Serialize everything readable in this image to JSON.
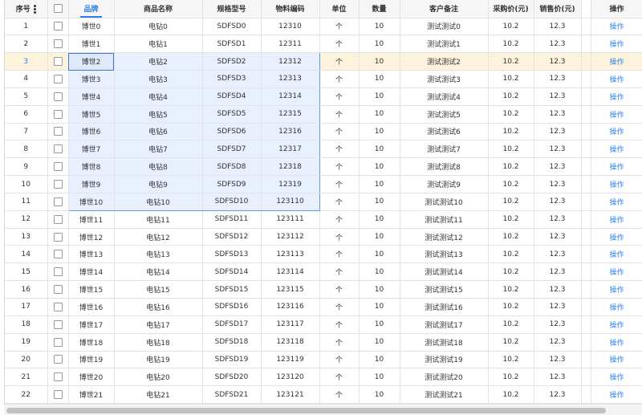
{
  "columns": {
    "idx": "序号",
    "brand": "品牌",
    "name": "商品名称",
    "spec": "规格型号",
    "code": "物料编码",
    "unit": "单位",
    "qty": "数量",
    "note": "客户备注",
    "buy": "采购价(元)",
    "sell": "销售价(元)",
    "action": "操作"
  },
  "icons": {
    "column_menu": "kebab-menu-icon",
    "row_select": "checkbox-icon"
  },
  "colors": {
    "accent": "#2f80ed",
    "highlight_row": "#fdf2dc",
    "selection": "#e8f0fd"
  },
  "highlighted_row": 3,
  "selected_range": {
    "from_row": 3,
    "to_row": 11,
    "from_col": "brand",
    "to_col": "code"
  },
  "rows": [
    {
      "idx": "1",
      "brand": "博世0",
      "name": "电钻0",
      "spec": "SDFSD0",
      "code": "12310",
      "unit": "个",
      "qty": "10",
      "note": "测试测试0",
      "buy": "10.2",
      "sell": "12.3",
      "action": "操作"
    },
    {
      "idx": "2",
      "brand": "博世1",
      "name": "电钻1",
      "spec": "SDFSD1",
      "code": "12311",
      "unit": "个",
      "qty": "10",
      "note": "测试测试1",
      "buy": "10.2",
      "sell": "12.3",
      "action": "操作"
    },
    {
      "idx": "3",
      "brand": "博世2",
      "name": "电钻2",
      "spec": "SDFSD2",
      "code": "12312",
      "unit": "个",
      "qty": "10",
      "note": "测试测试2",
      "buy": "10.2",
      "sell": "12.3",
      "action": "操作"
    },
    {
      "idx": "4",
      "brand": "博世3",
      "name": "电钻3",
      "spec": "SDFSD3",
      "code": "12313",
      "unit": "个",
      "qty": "10",
      "note": "测试测试3",
      "buy": "10.2",
      "sell": "12.3",
      "action": "操作"
    },
    {
      "idx": "5",
      "brand": "博世4",
      "name": "电钻4",
      "spec": "SDFSD4",
      "code": "12314",
      "unit": "个",
      "qty": "10",
      "note": "测试测试4",
      "buy": "10.2",
      "sell": "12.3",
      "action": "操作"
    },
    {
      "idx": "6",
      "brand": "博世5",
      "name": "电钻5",
      "spec": "SDFSD5",
      "code": "12315",
      "unit": "个",
      "qty": "10",
      "note": "测试测试5",
      "buy": "10.2",
      "sell": "12.3",
      "action": "操作"
    },
    {
      "idx": "7",
      "brand": "博世6",
      "name": "电钻6",
      "spec": "SDFSD6",
      "code": "12316",
      "unit": "个",
      "qty": "10",
      "note": "测试测试6",
      "buy": "10.2",
      "sell": "12.3",
      "action": "操作"
    },
    {
      "idx": "8",
      "brand": "博世7",
      "name": "电钻7",
      "spec": "SDFSD7",
      "code": "12317",
      "unit": "个",
      "qty": "10",
      "note": "测试测试7",
      "buy": "10.2",
      "sell": "12.3",
      "action": "操作"
    },
    {
      "idx": "9",
      "brand": "博世8",
      "name": "电钻8",
      "spec": "SDFSD8",
      "code": "12318",
      "unit": "个",
      "qty": "10",
      "note": "测试测试8",
      "buy": "10.2",
      "sell": "12.3",
      "action": "操作"
    },
    {
      "idx": "10",
      "brand": "博世9",
      "name": "电钻9",
      "spec": "SDFSD9",
      "code": "12319",
      "unit": "个",
      "qty": "10",
      "note": "测试测试9",
      "buy": "10.2",
      "sell": "12.3",
      "action": "操作"
    },
    {
      "idx": "11",
      "brand": "博世10",
      "name": "电钻10",
      "spec": "SDFSD10",
      "code": "123110",
      "unit": "个",
      "qty": "10",
      "note": "测试测试10",
      "buy": "10.2",
      "sell": "12.3",
      "action": "操作"
    },
    {
      "idx": "12",
      "brand": "博世11",
      "name": "电钻11",
      "spec": "SDFSD11",
      "code": "123111",
      "unit": "个",
      "qty": "10",
      "note": "测试测试11",
      "buy": "10.2",
      "sell": "12.3",
      "action": "操作"
    },
    {
      "idx": "13",
      "brand": "博世12",
      "name": "电钻12",
      "spec": "SDFSD12",
      "code": "123112",
      "unit": "个",
      "qty": "10",
      "note": "测试测试12",
      "buy": "10.2",
      "sell": "12.3",
      "action": "操作"
    },
    {
      "idx": "14",
      "brand": "博世13",
      "name": "电钻13",
      "spec": "SDFSD13",
      "code": "123113",
      "unit": "个",
      "qty": "10",
      "note": "测试测试13",
      "buy": "10.2",
      "sell": "12.3",
      "action": "操作"
    },
    {
      "idx": "15",
      "brand": "博世14",
      "name": "电钻14",
      "spec": "SDFSD14",
      "code": "123114",
      "unit": "个",
      "qty": "10",
      "note": "测试测试14",
      "buy": "10.2",
      "sell": "12.3",
      "action": "操作"
    },
    {
      "idx": "16",
      "brand": "博世15",
      "name": "电钻15",
      "spec": "SDFSD15",
      "code": "123115",
      "unit": "个",
      "qty": "10",
      "note": "测试测试15",
      "buy": "10.2",
      "sell": "12.3",
      "action": "操作"
    },
    {
      "idx": "17",
      "brand": "博世16",
      "name": "电钻16",
      "spec": "SDFSD16",
      "code": "123116",
      "unit": "个",
      "qty": "10",
      "note": "测试测试16",
      "buy": "10.2",
      "sell": "12.3",
      "action": "操作"
    },
    {
      "idx": "18",
      "brand": "博世17",
      "name": "电钻17",
      "spec": "SDFSD17",
      "code": "123117",
      "unit": "个",
      "qty": "10",
      "note": "测试测试17",
      "buy": "10.2",
      "sell": "12.3",
      "action": "操作"
    },
    {
      "idx": "19",
      "brand": "博世18",
      "name": "电钻18",
      "spec": "SDFSD18",
      "code": "123118",
      "unit": "个",
      "qty": "10",
      "note": "测试测试18",
      "buy": "10.2",
      "sell": "12.3",
      "action": "操作"
    },
    {
      "idx": "20",
      "brand": "博世19",
      "name": "电钻19",
      "spec": "SDFSD19",
      "code": "123119",
      "unit": "个",
      "qty": "10",
      "note": "测试测试19",
      "buy": "10.2",
      "sell": "12.3",
      "action": "操作"
    },
    {
      "idx": "21",
      "brand": "博世20",
      "name": "电钻20",
      "spec": "SDFSD20",
      "code": "123120",
      "unit": "个",
      "qty": "10",
      "note": "测试测试20",
      "buy": "10.2",
      "sell": "12.3",
      "action": "操作"
    },
    {
      "idx": "22",
      "brand": "博世21",
      "name": "电钻21",
      "spec": "SDFSD21",
      "code": "123121",
      "unit": "个",
      "qty": "10",
      "note": "测试测试21",
      "buy": "10.2",
      "sell": "12.3",
      "action": "操作"
    }
  ]
}
